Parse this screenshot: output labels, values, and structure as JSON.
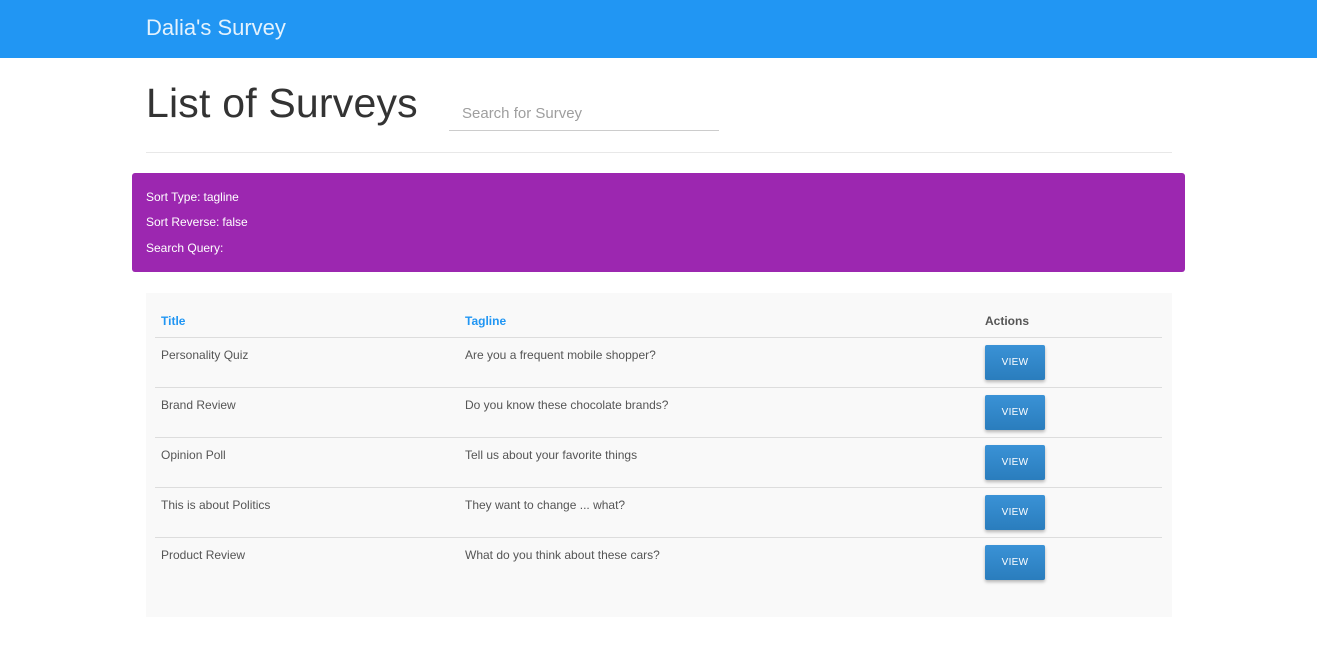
{
  "navbar": {
    "brand": "Dalia's Survey",
    "color": "#2196f3"
  },
  "page": {
    "title": "List of Surveys",
    "search": {
      "placeholder": "Search for Survey",
      "value": ""
    }
  },
  "info": {
    "color": "#9c27b0",
    "sort_type_label": "Sort Type:",
    "sort_type_value": "tagline",
    "sort_reverse_label": "Sort Reverse:",
    "sort_reverse_value": "false",
    "search_query_label": "Search Query:",
    "search_query_value": ""
  },
  "table": {
    "headers": {
      "title": "Title",
      "tagline": "Tagline",
      "actions": "Actions"
    },
    "rows": [
      {
        "title": "Personality Quiz",
        "tagline": "Are you a frequent mobile shopper?",
        "action": "VIEW"
      },
      {
        "title": "Brand Review",
        "tagline": "Do you know these chocolate brands?",
        "action": "VIEW"
      },
      {
        "title": "Opinion Poll",
        "tagline": "Tell us about your favorite things",
        "action": "VIEW"
      },
      {
        "title": "This is about Politics",
        "tagline": "They want to change ... what?",
        "action": "VIEW"
      },
      {
        "title": "Product Review",
        "tagline": "What do you think about these cars?",
        "action": "VIEW"
      }
    ]
  }
}
